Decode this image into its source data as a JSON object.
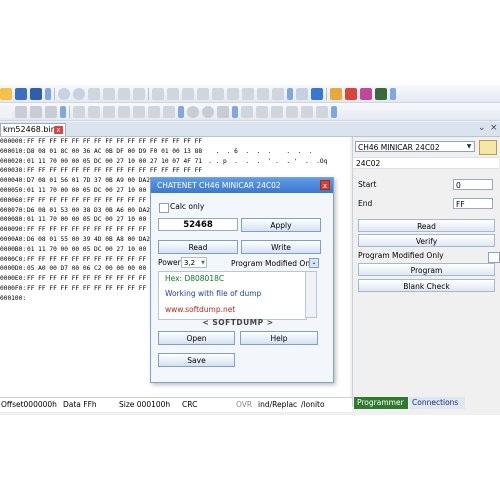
{
  "file_tab": {
    "label": "km52468.bin",
    "close": "x"
  },
  "hex_rows": [
    {
      "addr": "000000:",
      "bytes": "FF FF FF FF FF FF FF FF FF FF FF FF FF FF FF FF",
      "ascii": ""
    },
    {
      "addr": "000010:",
      "bytes": "D8 08 01 8C 00 36 AC 0B DF 00 D9 F0 01 00 13 88",
      "ascii": "  .  . 6  .  .  .    .  .  ."
    },
    {
      "addr": "000020:",
      "bytes": "01 11 70 00 00 05 DC 00 27 10 00 27 10 07 4F 71",
      "ascii": ". . p  .  .  .  ' .  . '  .  .Oq"
    },
    {
      "addr": "000030:",
      "bytes": "FF FF FF FF FF FF FF FF FF FF FF FF FF FF FF FF",
      "ascii": ""
    },
    {
      "addr": "000040:",
      "bytes": "D7 08 01 56 01 7D 37 0B A9 00 DA2",
      "ascii": ""
    },
    {
      "addr": "000050:",
      "bytes": "01 11 70 00 00 05 DC 00 27 10 00 2",
      "ascii": ""
    },
    {
      "addr": "000060:",
      "bytes": "FF FF FF FF FF FF FF FF FF FF FF F",
      "ascii": ""
    },
    {
      "addr": "000070:",
      "bytes": "D6 08 01 53 00 38 D3 0B A6 00 DA2",
      "ascii": ""
    },
    {
      "addr": "000080:",
      "bytes": "01 11 70 00 00 05 DC 00 27 10 00 2",
      "ascii": ""
    },
    {
      "addr": "000090:",
      "bytes": "FF FF FF FF FF FF FF FF FF FF FF F",
      "ascii": ""
    },
    {
      "addr": "0000A0:",
      "bytes": "D6 08 01 55 00 39 4D 0B A8 00 DA2",
      "ascii": ""
    },
    {
      "addr": "0000B0:",
      "bytes": "01 11 70 00 00 05 DC 00 27 10 00 2",
      "ascii": ""
    },
    {
      "addr": "0000C0:",
      "bytes": "FF FF FF FF FF FF FF FF FF FF FF F",
      "ascii": ""
    },
    {
      "addr": "0000D0:",
      "bytes": "05 A0 00 D7 00 06 C2 00 00 00 00 0",
      "ascii": ""
    },
    {
      "addr": "0000E0:",
      "bytes": "FF FF FF FF FF FF FF FF FF FF FF F",
      "ascii": ""
    },
    {
      "addr": "0000F0:",
      "bytes": "FF FF FF FF FF FF FF FF FF FF FF F",
      "ascii": ""
    },
    {
      "addr": "000100:",
      "bytes": "",
      "ascii": ""
    }
  ],
  "right_panel": {
    "device_select": "CH46 MINICAR 24C02",
    "chip": "24C02",
    "start_label": "Start",
    "start_value": "0",
    "end_label": "End",
    "end_value": "FF",
    "read": "Read",
    "verify": "Verify",
    "program_modified_only": "Program Modified Only",
    "program": "Program",
    "blank_check": "Blank Check"
  },
  "bottom_tabs": {
    "programmer": "Programmer",
    "connections": "Connections"
  },
  "statusbar": {
    "offset": "Offset000000h",
    "data": "Data FFh",
    "size": "Size 000100h",
    "crc": "CRC",
    "ovr": "OVR",
    "mode": "ind/Replac",
    "monitor": "/lonito"
  },
  "dialog": {
    "title": "CHATENET CH46 MINICAR 24C02",
    "close": "x",
    "calc_only": "Calc only",
    "input_value": "52468",
    "apply": "Apply",
    "read": "Read",
    "write": "Write",
    "power_label": "Power",
    "power_value": "3,2",
    "program_modified": "Program Modified Onl",
    "hex_line": "Hex: D808018C",
    "working_line": "Working with file of dump",
    "url_line": "www.softdump.net",
    "brand": "< SOFTDUMP >",
    "open": "Open",
    "help": "Help",
    "save": "Save"
  },
  "colors": {
    "title_bar": "#3a78cf",
    "hex_green": "#0a7a2a",
    "link_red": "#c0281c",
    "working_blue": "#1f3fb0",
    "accent_tab": "#2a7a2a"
  }
}
